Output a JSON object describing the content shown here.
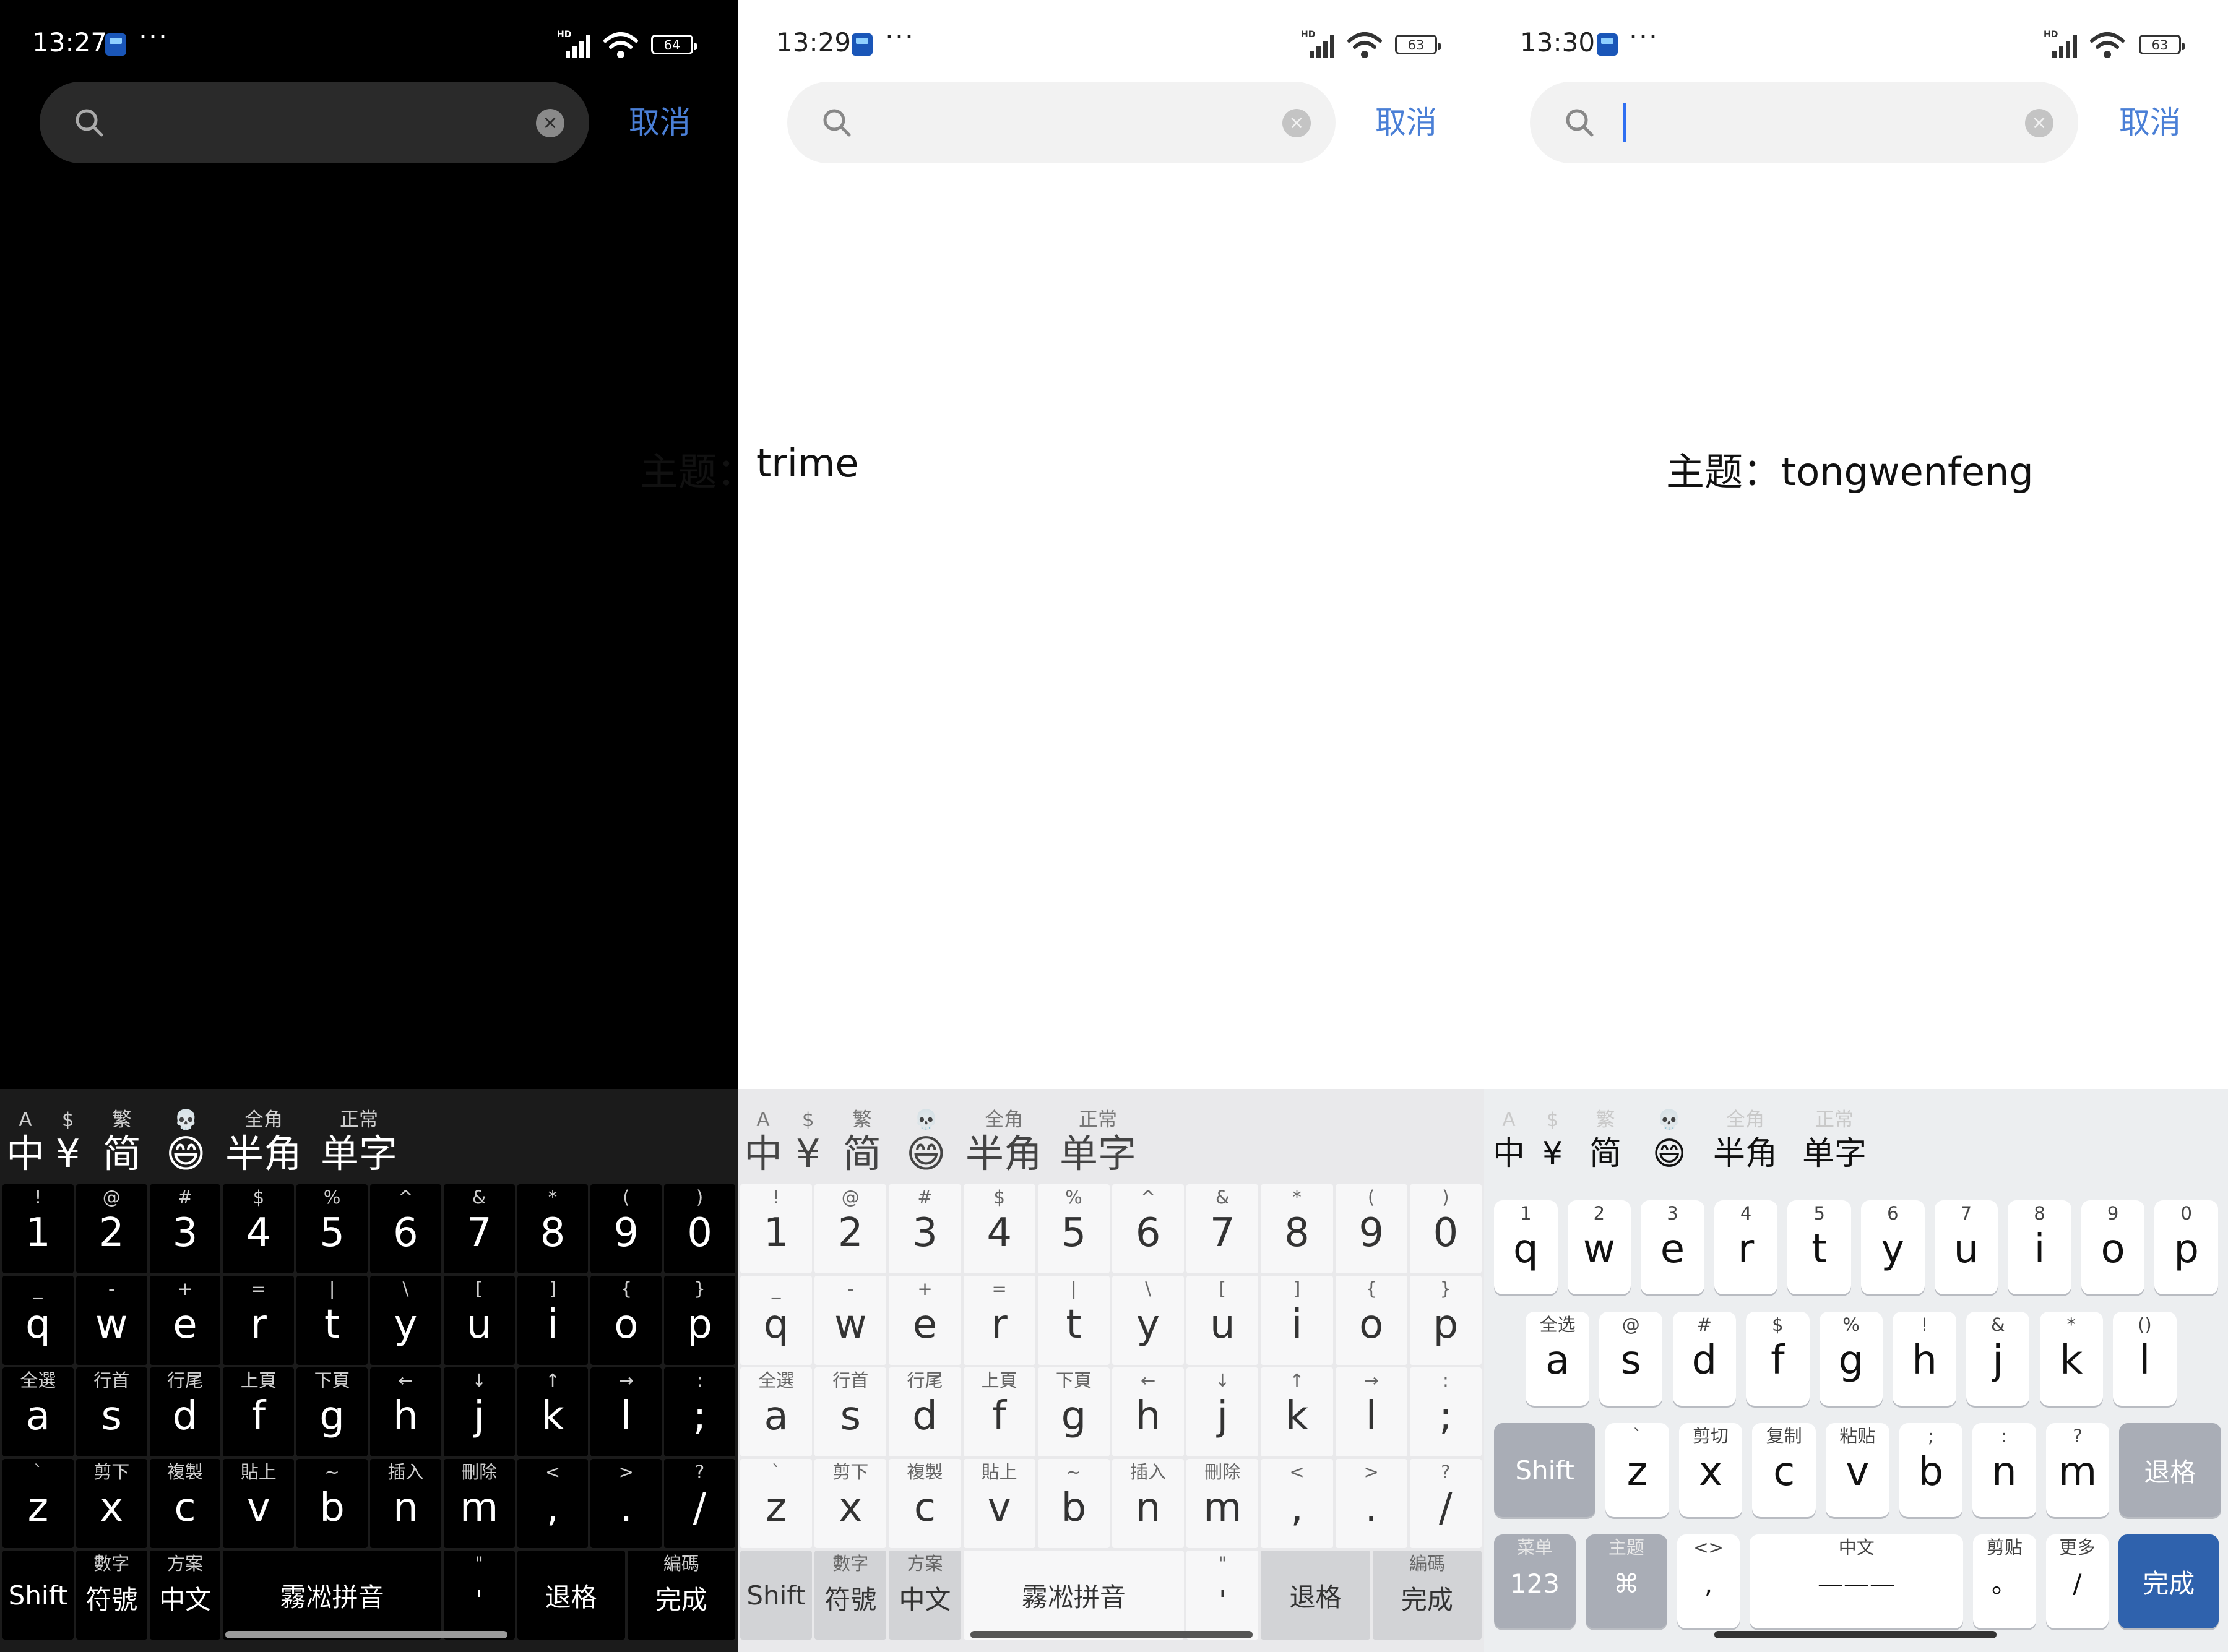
{
  "panels": [
    {
      "status": {
        "time": "13:27",
        "battery": "64",
        "hd": "HD"
      },
      "cancel": "取消",
      "theme": "主题：",
      "theme_name": "trime"
    },
    {
      "status": {
        "time": "13:29",
        "battery": "63",
        "hd": "HD"
      },
      "cancel": "取消"
    },
    {
      "status": {
        "time": "13:30",
        "battery": "63",
        "hd": "HD"
      },
      "cancel": "取消",
      "theme": "主题：",
      "theme_name": "tongwenfeng"
    }
  ],
  "status_dots": "···",
  "clear_glyph": "×",
  "candidates": [
    {
      "hint": "A",
      "main": "中"
    },
    {
      "hint": "$",
      "main": "¥"
    },
    {
      "hint": "繁",
      "main": "简"
    },
    {
      "hint": "💀",
      "main": "😄"
    },
    {
      "hint": "全角",
      "main": "半角"
    },
    {
      "hint": "正常",
      "main": "单字"
    }
  ],
  "trime_keys": {
    "row1": [
      {
        "h": "!",
        "m": "1"
      },
      {
        "h": "@",
        "m": "2"
      },
      {
        "h": "#",
        "m": "3"
      },
      {
        "h": "$",
        "m": "4"
      },
      {
        "h": "%",
        "m": "5"
      },
      {
        "h": "^",
        "m": "6"
      },
      {
        "h": "&",
        "m": "7"
      },
      {
        "h": "*",
        "m": "8"
      },
      {
        "h": "(",
        "m": "9"
      },
      {
        "h": ")",
        "m": "0"
      }
    ],
    "row2": [
      {
        "h": "_",
        "m": "q"
      },
      {
        "h": "-",
        "m": "w"
      },
      {
        "h": "+",
        "m": "e"
      },
      {
        "h": "=",
        "m": "r"
      },
      {
        "h": "|",
        "m": "t"
      },
      {
        "h": "\\",
        "m": "y"
      },
      {
        "h": "[",
        "m": "u"
      },
      {
        "h": "]",
        "m": "i"
      },
      {
        "h": "{",
        "m": "o"
      },
      {
        "h": "}",
        "m": "p"
      }
    ],
    "row3": [
      {
        "h": "全選",
        "m": "a"
      },
      {
        "h": "行首",
        "m": "s"
      },
      {
        "h": "行尾",
        "m": "d"
      },
      {
        "h": "上頁",
        "m": "f"
      },
      {
        "h": "下頁",
        "m": "g"
      },
      {
        "h": "←",
        "m": "h"
      },
      {
        "h": "↓",
        "m": "j"
      },
      {
        "h": "↑",
        "m": "k"
      },
      {
        "h": "→",
        "m": "l"
      },
      {
        "h": ":",
        "m": ";"
      }
    ],
    "row4": [
      {
        "h": "`",
        "m": "z"
      },
      {
        "h": "剪下",
        "m": "x"
      },
      {
        "h": "複製",
        "m": "c"
      },
      {
        "h": "貼上",
        "m": "v"
      },
      {
        "h": "~",
        "m": "b"
      },
      {
        "h": "插入",
        "m": "n"
      },
      {
        "h": "刪除",
        "m": "m"
      },
      {
        "h": "<",
        "m": ","
      },
      {
        "h": ">",
        "m": "."
      },
      {
        "h": "?",
        "m": "/"
      }
    ],
    "row5": [
      {
        "h": "",
        "m": "Shift"
      },
      {
        "h": "數字",
        "m": "符號"
      },
      {
        "h": "方案",
        "m": "中文"
      },
      {
        "h": "",
        "m": "霧凇拼音"
      },
      {
        "h": "\"",
        "m": "'"
      },
      {
        "h": "",
        "m": "退格"
      },
      {
        "h": "編碼",
        "m": "完成"
      }
    ]
  },
  "twf_keys": {
    "row1": [
      {
        "h": "1",
        "m": "q"
      },
      {
        "h": "2",
        "m": "w"
      },
      {
        "h": "3",
        "m": "e"
      },
      {
        "h": "4",
        "m": "r"
      },
      {
        "h": "5",
        "m": "t"
      },
      {
        "h": "6",
        "m": "y"
      },
      {
        "h": "7",
        "m": "u"
      },
      {
        "h": "8",
        "m": "i"
      },
      {
        "h": "9",
        "m": "o"
      },
      {
        "h": "0",
        "m": "p"
      }
    ],
    "row2": [
      {
        "h": "全选",
        "m": "a"
      },
      {
        "h": "@",
        "m": "s"
      },
      {
        "h": "#",
        "m": "d"
      },
      {
        "h": "$",
        "m": "f"
      },
      {
        "h": "%",
        "m": "g"
      },
      {
        "h": "!",
        "m": "h"
      },
      {
        "h": "&",
        "m": "j"
      },
      {
        "h": "*",
        "m": "k"
      },
      {
        "h": "()",
        "m": "l"
      }
    ],
    "row3": [
      {
        "h": "",
        "m": "Shift"
      },
      {
        "h": "`",
        "m": "z"
      },
      {
        "h": "剪切",
        "m": "x"
      },
      {
        "h": "复制",
        "m": "c"
      },
      {
        "h": "粘贴",
        "m": "v"
      },
      {
        "h": ";",
        "m": "b"
      },
      {
        "h": ":",
        "m": "n"
      },
      {
        "h": "?",
        "m": "m"
      },
      {
        "h": "",
        "m": "退格"
      }
    ],
    "row4": [
      {
        "h": "菜单",
        "m": "123"
      },
      {
        "h": "主题",
        "m": "⌘"
      },
      {
        "h": "<>",
        "m": ","
      },
      {
        "h": "中文",
        "m": "———"
      },
      {
        "h": "剪贴",
        "m": "。"
      },
      {
        "h": "更多",
        "m": "/"
      },
      {
        "h": "",
        "m": "完成"
      }
    ]
  },
  "colors": {
    "accent": "#4a7fd6",
    "caret": "#2f6ff2",
    "done_key": "#2f62ad"
  },
  "icons": [
    "search-icon",
    "clear-icon",
    "signal-icon",
    "wifi-icon",
    "battery-icon",
    "app-notification-icon"
  ]
}
